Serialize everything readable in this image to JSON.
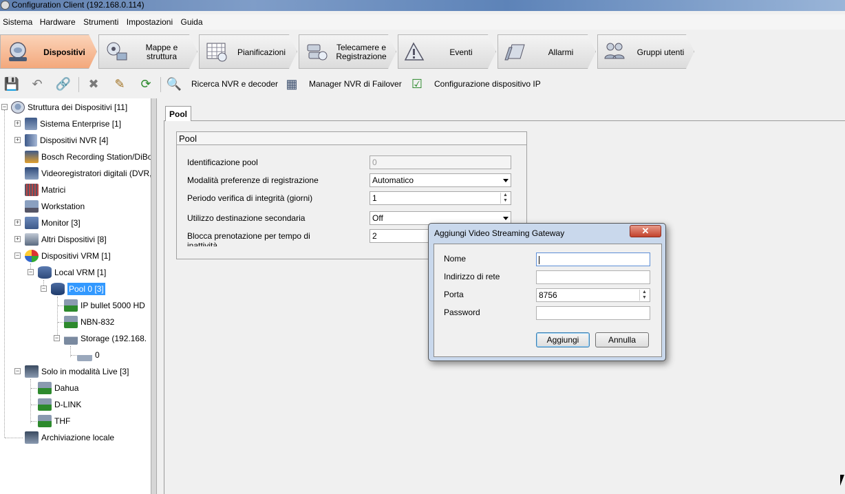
{
  "window": {
    "title": "Configuration Client (192.168.0.114)"
  },
  "menu": {
    "items": [
      "Sistema",
      "Hardware",
      "Strumenti",
      "Impostazioni",
      "Guida"
    ]
  },
  "nav": {
    "tabs": [
      {
        "label": "Dispositivi",
        "icon": "devices-icon",
        "active": true
      },
      {
        "label": "Mappe e struttura",
        "icon": "maps-icon",
        "active": false
      },
      {
        "label": "Pianificazioni",
        "icon": "schedule-icon",
        "active": false
      },
      {
        "label": "Telecamere e Registrazione",
        "icon": "cameras-icon",
        "active": false
      },
      {
        "label": "Eventi",
        "icon": "events-icon",
        "active": false
      },
      {
        "label": "Allarmi",
        "icon": "alarms-icon",
        "active": false
      },
      {
        "label": "Gruppi utenti",
        "icon": "user-groups-icon",
        "active": false
      }
    ]
  },
  "toolbar": {
    "search_nvr": "Ricerca NVR e decoder",
    "failover_manager": "Manager NVR di Failover",
    "ip_device_config": "Configurazione dispositivo IP"
  },
  "tree": {
    "root": "Struttura dei Dispositivi [11]",
    "items": [
      {
        "label": "Sistema Enterprise [1]"
      },
      {
        "label": "Dispositivi NVR [4]"
      },
      {
        "label": "Bosch Recording Station/DiBo"
      },
      {
        "label": "Videoregistratori digitali (DVR,"
      },
      {
        "label": "Matrici"
      },
      {
        "label": "Workstation"
      },
      {
        "label": "Monitor [3]"
      },
      {
        "label": "Altri Dispositivi [8]"
      },
      {
        "label": "Dispositivi VRM [1]"
      },
      {
        "label": "Local VRM [1]"
      },
      {
        "label": "Pool 0 [3]"
      },
      {
        "label": "IP bullet 5000 HD"
      },
      {
        "label": "NBN-832"
      },
      {
        "label": "Storage (192.168."
      },
      {
        "label": "0"
      },
      {
        "label": "Solo in modalità Live [3]"
      },
      {
        "label": "Dahua"
      },
      {
        "label": "D-LINK"
      },
      {
        "label": "THF"
      },
      {
        "label": "Archiviazione locale"
      }
    ]
  },
  "content": {
    "tab": "Pool",
    "group_title": "Pool",
    "fields": {
      "pool_id": {
        "label": "Identificazione pool",
        "value": "0"
      },
      "rec_pref": {
        "label": "Modalità preferenze di registrazione",
        "value": "Automatico"
      },
      "integrity": {
        "label": "Periodo verifica di integrità (giorni)",
        "value": "1"
      },
      "secondary": {
        "label": "Utilizzo destinazione secondaria",
        "value": "Off"
      },
      "block": {
        "label": "Blocca prenotazione per tempo di inattività",
        "value": "2"
      }
    }
  },
  "dialog": {
    "title": "Aggiungi Video Streaming Gateway",
    "close": "✕",
    "name_label": "Nome",
    "name_value": "",
    "address_label": "Indirizzo di rete",
    "address_value": "",
    "port_label": "Porta",
    "port_value": "8756",
    "password_label": "Password",
    "password_value": "",
    "ok": "Aggiungi",
    "cancel": "Annulla"
  }
}
